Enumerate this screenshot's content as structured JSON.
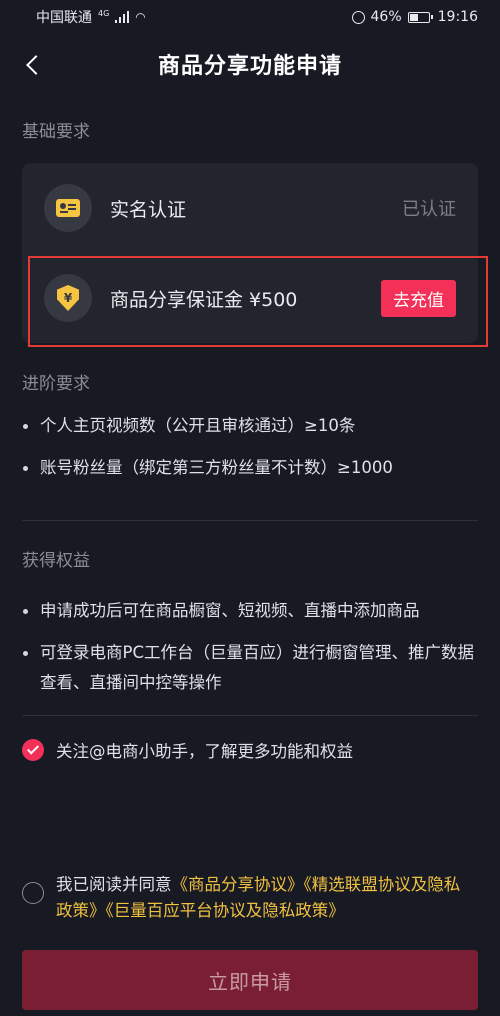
{
  "status_bar": {
    "carrier": "中国联通",
    "network": "4G",
    "battery": "46%",
    "time": "19:16"
  },
  "nav": {
    "title": "商品分享功能申请",
    "back_icon": "chevron-left-icon"
  },
  "basic_requirements": {
    "title": "基础要求",
    "items": [
      {
        "label": "实名认证",
        "status": "已认证",
        "icon": "id-card-icon"
      },
      {
        "label": "商品分享保证金 ¥500",
        "action": "去充值",
        "icon": "yuan-shield-icon"
      }
    ]
  },
  "advanced_requirements": {
    "title": "进阶要求",
    "items": [
      "个人主页视频数（公开且审核通过）≥10条",
      "账号粉丝量（绑定第三方粉丝量不计数）≥1000"
    ]
  },
  "benefits": {
    "title": "获得权益",
    "items": [
      "申请成功后可在商品橱窗、短视频、直播中添加商品",
      "可登录电商PC工作台（巨量百应）进行橱窗管理、推广数据查看、直播间中控等操作"
    ]
  },
  "follow": {
    "label": "关注@电商小助手，了解更多功能和权益",
    "checked": true
  },
  "agreement": {
    "prefix": "我已阅读并同意",
    "links": [
      "《商品分享协议》",
      "《精选联盟协议及隐私政策》",
      "《巨量百应平台协议及隐私政策》"
    ],
    "checked": false
  },
  "submit": {
    "label": "立即申请"
  },
  "colors": {
    "background": "#171923",
    "card": "#22242e",
    "accent": "#f33158",
    "link": "#f0c040",
    "submit_disabled": "#7a1f33"
  }
}
